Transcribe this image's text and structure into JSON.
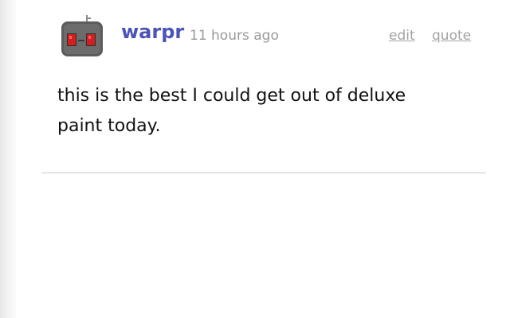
{
  "comment": {
    "author": "warpr",
    "timestamp": "11 hours ago",
    "actions": {
      "edit_label": "edit",
      "quote_label": "quote"
    },
    "body": "this is the best I could get out of deluxe paint today."
  },
  "avatar": {
    "icon": "robot-avatar-icon",
    "colors": {
      "body": "#5f5f5f",
      "eyes": "#d41f1f"
    }
  },
  "colors": {
    "author_link": "#4b53b8",
    "muted_text": "#999999",
    "action_link": "#a3a3a3",
    "body_text": "#111111",
    "divider": "#c9c9c9"
  }
}
